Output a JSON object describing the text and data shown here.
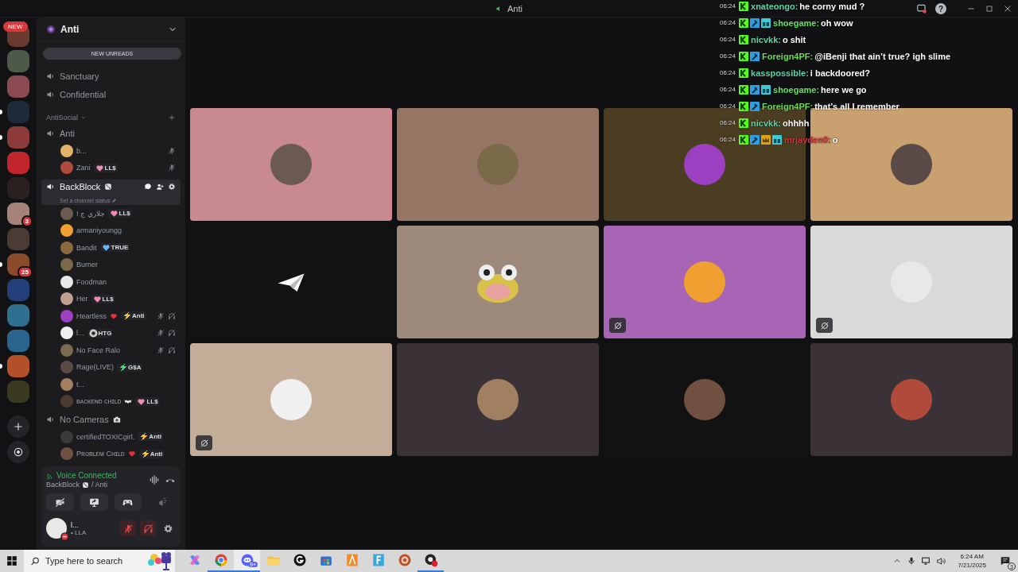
{
  "window": {
    "title": "Anti",
    "help": "?"
  },
  "rail": {
    "new_label": "NEW",
    "servers": [
      {
        "unread": false
      },
      {
        "unread": false
      },
      {
        "unread": false
      },
      {
        "unread": true
      },
      {
        "unread": true
      },
      {
        "unread": false
      },
      {
        "unread": false
      },
      {
        "unread": false,
        "badge": "3"
      },
      {
        "unread": false
      },
      {
        "unread": true,
        "badge": "25"
      },
      {
        "unread": false
      },
      {
        "unread": false
      },
      {
        "unread": false
      },
      {
        "unread": true
      },
      {
        "unread": false
      }
    ]
  },
  "sidebar": {
    "server_name": "Anti",
    "new_unreads": "NEW UNREADS",
    "items": [
      {
        "kind": "channel",
        "name": "Sanctuary",
        "selected": false
      },
      {
        "kind": "channel",
        "name": "Confidential",
        "selected": false
      },
      {
        "kind": "category",
        "name": "AntiSocial"
      },
      {
        "kind": "channel",
        "name": "Anti",
        "selected": false,
        "users": [
          {
            "name": "b...",
            "muted": true,
            "deafened": false
          },
          {
            "name": "Zani",
            "tags": [
              {
                "kind": "heart",
                "color": "#f08cb4",
                "label": "LL$"
              }
            ],
            "muted": true,
            "deafened": false
          }
        ]
      },
      {
        "kind": "channel",
        "name": "BackBlock",
        "emoji": {
          "kind": "dice"
        },
        "status": "Set a channel status",
        "selected": true,
        "users": [
          {
            "name": "! جلاري ج",
            "tags": [
              {
                "kind": "heart",
                "color": "#f08cb4",
                "label": "LL$"
              }
            ],
            "muted": false,
            "deafened": false
          },
          {
            "name": "armaniyoungg",
            "muted": false,
            "deafened": false
          },
          {
            "name": "Bandit",
            "tags": [
              {
                "kind": "heart",
                "color": "#6cb6f0",
                "label": "TRUE"
              }
            ],
            "muted": false,
            "deafened": false
          },
          {
            "name": "Burner",
            "muted": false,
            "deafened": false
          },
          {
            "name": "Foodman",
            "muted": false,
            "deafened": false
          },
          {
            "name": "Her",
            "tags": [
              {
                "kind": "heart",
                "color": "#f08cb4",
                "label": "LL$"
              }
            ],
            "muted": false,
            "deafened": false
          },
          {
            "name": "Heartless",
            "emoji": {
              "kind": "heart"
            },
            "tags": [
              {
                "kind": "bolt",
                "color": "#f2c232",
                "label": "Anti"
              }
            ],
            "muted": true,
            "deafened": true
          },
          {
            "name": "l...",
            "tags": [
              {
                "kind": "ring",
                "color": "#d0d0d0",
                "label": "HTG"
              }
            ],
            "muted": true,
            "deafened": true
          },
          {
            "name": "No Face Ralo",
            "muted": true,
            "deafened": true
          },
          {
            "name": "Rage(LIVE)",
            "tags": [
              {
                "kind": "bolt",
                "color": "#4fd67a",
                "label": "G$A"
              }
            ],
            "muted": false,
            "deafened": false
          },
          {
            "name": "t...",
            "muted": false,
            "deafened": false
          },
          {
            "name": "ʙᴀᴄᴋᴇɴᴅ ᴄʜɪʟᴅ",
            "emoji": {
              "kind": "bat"
            },
            "tags": [
              {
                "kind": "heart",
                "color": "#f08cb4",
                "label": "LL$"
              }
            ],
            "muted": false,
            "deafened": false
          }
        ]
      },
      {
        "kind": "channel",
        "name": "No Cameras",
        "emoji": {
          "kind": "camera"
        },
        "selected": false,
        "users": [
          {
            "name": "certifiedTOXICgirl.",
            "tags": [
              {
                "kind": "bolt",
                "color": "#f2c232",
                "label": "Anti"
              }
            ],
            "muted": false,
            "deafened": false
          },
          {
            "name": "Pʀᴏʙʟᴇᴍ Cʜɪʟᴅ",
            "emoji": {
              "kind": "heart"
            },
            "tags": [
              {
                "kind": "bolt",
                "color": "#f2c232",
                "label": "Anti"
              }
            ],
            "muted": false,
            "deafened": false
          }
        ]
      }
    ]
  },
  "voice_panel": {
    "status": "Voice Connected",
    "channel": "BackBlock",
    "server": "/ Anti",
    "user": {
      "name": "l...",
      "status": "• LLA",
      "muted": true,
      "deafened": true
    }
  },
  "grid": {
    "tiles": [
      {
        "kind": "avatar",
        "color": "#c98a8f",
        "status_icon": false
      },
      {
        "kind": "avatar",
        "color": "#957564",
        "status_icon": false
      },
      {
        "kind": "avatar",
        "color": "#4b3d21",
        "status_icon": false
      },
      {
        "kind": "avatar",
        "color": "#c9a06f",
        "status_icon": false
      },
      {
        "kind": "plane",
        "color": "#121212",
        "status_icon": false
      },
      {
        "kind": "mascot",
        "color": "#9e8a7b",
        "status_icon": false
      },
      {
        "kind": "avatar",
        "color": "#a865b5",
        "status_icon": true
      },
      {
        "kind": "avatar",
        "color": "#d9d9d9",
        "status_icon": true
      },
      {
        "kind": "avatar",
        "color": "#c4ad98",
        "status_icon": true
      },
      {
        "kind": "avatar",
        "color": "#3a3236",
        "status_icon": false
      },
      {
        "kind": "avatar",
        "color": "#121212",
        "status_icon": false
      },
      {
        "kind": "avatar",
        "color": "#3a3236",
        "status_icon": false
      }
    ]
  },
  "chat": {
    "lines": [
      {
        "time": "06:24",
        "badges": [
          {
            "kind": "k"
          }
        ],
        "user": "xnateongo:",
        "color": "#5fd3a8",
        "text": "he corny mud ?"
      },
      {
        "time": "06:24",
        "badges": [
          {
            "kind": "k"
          },
          {
            "kind": "hammer"
          },
          {
            "kind": "gift"
          }
        ],
        "user": "shoegame:",
        "color": "#62e35a",
        "text": "oh wow"
      },
      {
        "time": "06:24",
        "badges": [
          {
            "kind": "k"
          }
        ],
        "user": "nicvkk:",
        "color": "#5fd3a8",
        "text": "o shit"
      },
      {
        "time": "06:24",
        "badges": [
          {
            "kind": "k"
          },
          {
            "kind": "hammer"
          }
        ],
        "user": "Foreign4PF:",
        "color": "#6bdb4f",
        "text": "@iBenji that ain’t true? igh slime"
      },
      {
        "time": "06:24",
        "badges": [
          {
            "kind": "k"
          }
        ],
        "user": "kasspossible:",
        "color": "#5fd3a8",
        "text": "i backdoored?"
      },
      {
        "time": "06:24",
        "badges": [
          {
            "kind": "k"
          },
          {
            "kind": "hammer"
          },
          {
            "kind": "gift"
          }
        ],
        "user": "shoegame:",
        "color": "#62e35a",
        "text": "here we go"
      },
      {
        "time": "06:24",
        "badges": [
          {
            "kind": "k"
          },
          {
            "kind": "hammer"
          }
        ],
        "user": "Foreign4PF:",
        "color": "#6bdb4f",
        "text": "that’s all I remember"
      },
      {
        "time": "06:24",
        "badges": [
          {
            "kind": "k"
          }
        ],
        "user": "nicvkk:",
        "color": "#5fd3a8",
        "text": "ohhhh"
      },
      {
        "time": "06:24",
        "badges": [
          {
            "kind": "k"
          },
          {
            "kind": "hammer"
          },
          {
            "kind": "crown"
          },
          {
            "kind": "gift"
          }
        ],
        "user": "mrjayden0:",
        "color": "#d9363e",
        "text": "o"
      }
    ]
  },
  "taskbar": {
    "search_placeholder": "Type here to search",
    "apps": [
      {
        "kind": "copilot",
        "running": false,
        "selected": false
      },
      {
        "kind": "chrome",
        "running": true,
        "selected": false
      },
      {
        "kind": "discord",
        "running": true,
        "selected": true,
        "badge": "9+"
      },
      {
        "kind": "folder",
        "running": false,
        "selected": false
      },
      {
        "kind": "ghub",
        "running": false,
        "selected": false
      },
      {
        "kind": "store",
        "running": false,
        "selected": false
      },
      {
        "kind": "launcher",
        "running": false,
        "selected": false
      },
      {
        "kind": "fapp",
        "running": false,
        "selected": false
      },
      {
        "kind": "target",
        "running": false,
        "selected": false
      },
      {
        "kind": "record",
        "running": true,
        "selected": false
      }
    ],
    "time": "6:24 AM",
    "date": "7/21/2025",
    "notifications": "3"
  }
}
